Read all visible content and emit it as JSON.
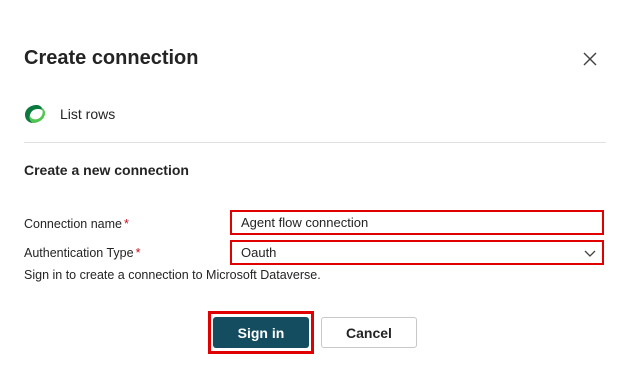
{
  "dialog": {
    "title": "Create connection",
    "close_icon": "close-icon"
  },
  "action": {
    "icon": "dataverse-icon",
    "label": "List rows"
  },
  "section_title": "Create a new connection",
  "fields": {
    "connection_name": {
      "label": "Connection name",
      "required_marker": "*",
      "value": "Agent flow connection"
    },
    "authentication_type": {
      "label": "Authentication Type",
      "required_marker": "*",
      "value": "Oauth",
      "chevron_icon": "chevron-down-icon"
    }
  },
  "help_text": "Sign in to create a connection to Microsoft Dataverse.",
  "buttons": {
    "sign_in": "Sign in",
    "cancel": "Cancel"
  },
  "colors": {
    "primary": "#134d5f",
    "highlight": "#e00000",
    "required": "#c50f1f"
  }
}
